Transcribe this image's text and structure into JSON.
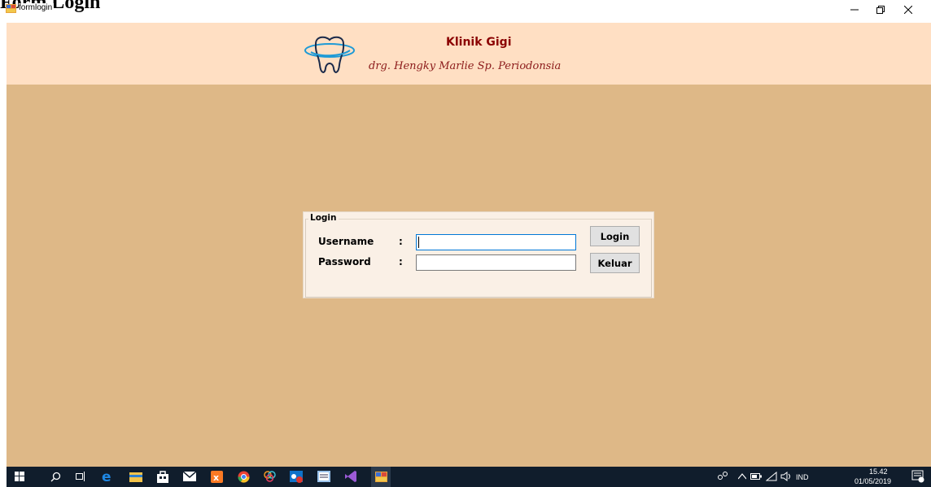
{
  "document_heading": "Form Login",
  "window": {
    "title": "formlogin",
    "icon": "form-app-icon",
    "controls": [
      "minimize-icon",
      "maximize-icon",
      "close-icon"
    ]
  },
  "header": {
    "clinic_name": "Klinik Gigi",
    "doctor_name": "drg. Hengky Marlie Sp. Periodonsia",
    "logo": "tooth-logo-icon",
    "background": "#ffdfc3",
    "text_color": "#8b0000"
  },
  "main": {
    "background": "#deb887"
  },
  "login_form": {
    "group_title": "Login",
    "username_label": "Username",
    "password_label": "Password",
    "colon": ":",
    "username_value": "",
    "password_value": "",
    "login_button": "Login",
    "exit_button": "Keluar",
    "panel_background": "#faf0e6"
  },
  "taskbar": {
    "icons": [
      "windows-start-icon",
      "search-icon",
      "task-view-icon",
      "edge-icon",
      "file-explorer-icon",
      "store-icon",
      "mail-icon",
      "xampp-icon",
      "chrome-icon",
      "paint-icon",
      "outlook-icon",
      "notepad-icon",
      "visual-studio-icon",
      "winforms-app-icon"
    ],
    "tray": {
      "language": "IND",
      "time": "15.42",
      "date": "01/05/2019"
    },
    "background": "#101d2c"
  }
}
